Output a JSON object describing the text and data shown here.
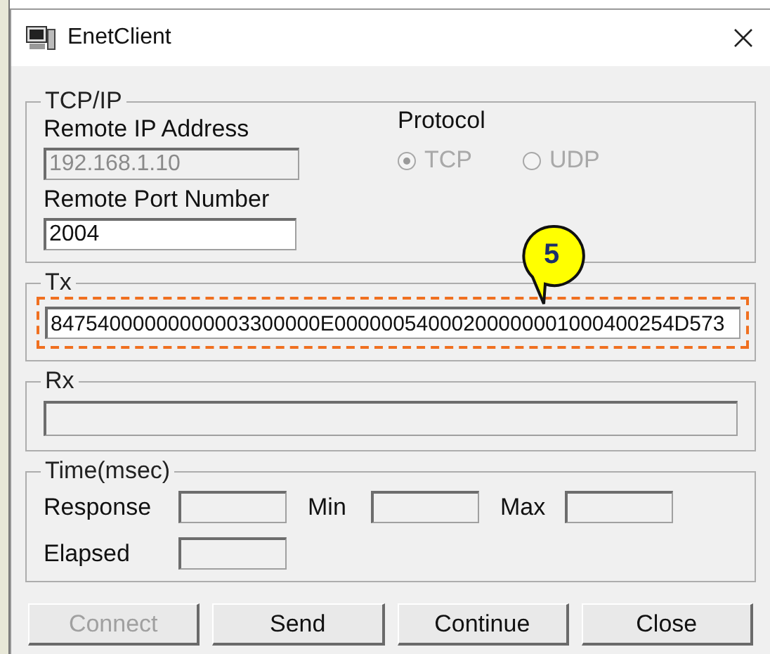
{
  "window": {
    "title": "EnetClient"
  },
  "tcpip": {
    "title": "TCP/IP",
    "ip_label": "Remote IP Address",
    "ip_value": "192.168.1.10",
    "ip_disabled": true,
    "port_label": "Remote Port Number",
    "port_value": "2004",
    "protocol_label": "Protocol",
    "protocols": [
      {
        "label": "TCP",
        "selected": true,
        "disabled": true
      },
      {
        "label": "UDP",
        "selected": false,
        "disabled": true
      }
    ]
  },
  "tx": {
    "title": "Tx",
    "value": "84754000000000003300000E00000054000200000001000400254D573",
    "highlighted": true
  },
  "callout": {
    "label": "5"
  },
  "rx": {
    "title": "Rx"
  },
  "time": {
    "title": "Time(msec)",
    "fields": [
      {
        "label": "Response"
      },
      {
        "label": "Min"
      },
      {
        "label": "Max"
      },
      {
        "label": "Elapsed"
      }
    ]
  },
  "buttons": [
    {
      "label": "Connect",
      "disabled": true
    },
    {
      "label": "Send",
      "disabled": false
    },
    {
      "label": "Continue",
      "disabled": false
    },
    {
      "label": "Close",
      "disabled": false
    }
  ]
}
